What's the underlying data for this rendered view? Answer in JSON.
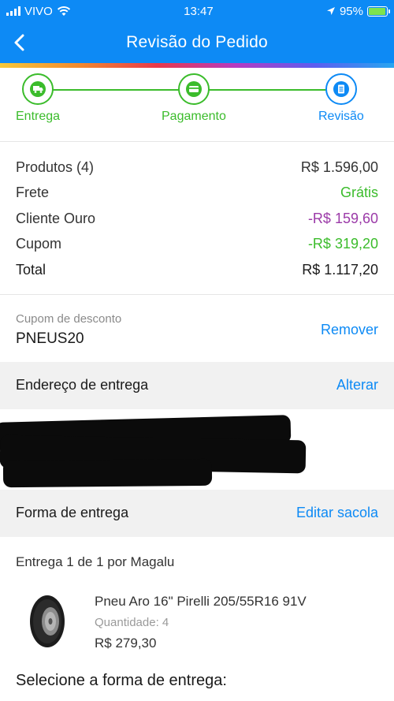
{
  "status_bar": {
    "carrier": "VIVO",
    "time": "13:47",
    "battery": "95%",
    "battery_level": 0.95
  },
  "header": {
    "title": "Revisão do Pedido",
    "back_icon": "chevron-left-icon"
  },
  "stepper": {
    "steps": [
      {
        "label": "Entrega",
        "icon": "truck-icon",
        "state": "done"
      },
      {
        "label": "Pagamento",
        "icon": "credit-card-icon",
        "state": "done"
      },
      {
        "label": "Revisão",
        "icon": "document-icon",
        "state": "current"
      }
    ]
  },
  "summary": {
    "products_label": "Produtos (4)",
    "products_value": "R$ 1.596,00",
    "shipping_label": "Frete",
    "shipping_value": "Grátis",
    "gold_label": "Cliente Ouro",
    "gold_value": "-R$ 159,60",
    "coupon_label": "Cupom",
    "coupon_value": "-R$ 319,20",
    "total_label": "Total",
    "total_value": "R$ 1.117,20"
  },
  "coupon": {
    "caption": "Cupom de desconto",
    "code": "PNEUS20",
    "remove_label": "Remover"
  },
  "address_section": {
    "title": "Endereço de entrega",
    "action": "Alterar"
  },
  "delivery_section": {
    "title": "Forma de entrega",
    "action": "Editar sacola"
  },
  "delivery": {
    "info": "Entrega 1 de 1 por Magalu",
    "product_name": "Pneu Aro 16\" Pirelli 205/55R16 91V",
    "quantity": "Quantidade: 4",
    "price": "R$ 279,30",
    "select_title": "Selecione a forma de entrega:"
  },
  "colors": {
    "primary": "#0d8af5",
    "green": "#3bbc2b",
    "purple": "#9b3aa8"
  }
}
